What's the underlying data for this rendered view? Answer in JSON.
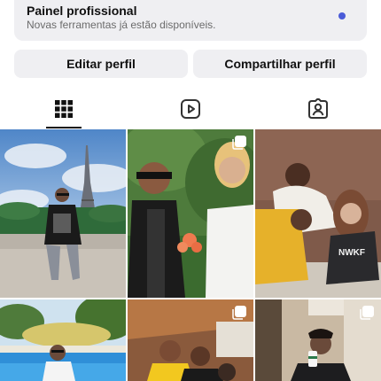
{
  "panel": {
    "title": "Painel profissional",
    "subtitle": "Novas ferramentas já estão disponíveis."
  },
  "buttons": {
    "edit_profile": "Editar perfil",
    "share_profile": "Compartilhar perfil"
  },
  "tabs": [
    {
      "name": "grid",
      "icon": "grid-icon",
      "selected": true
    },
    {
      "name": "reels",
      "icon": "reels-icon",
      "selected": false
    },
    {
      "name": "tagged",
      "icon": "tagged-icon",
      "selected": false
    }
  ],
  "colors": {
    "accent_dot": "#4a5bd8",
    "button_bg": "#efeff2"
  },
  "posts": [
    {
      "icon": "",
      "desc": "man posing near Eiffel Tower"
    },
    {
      "icon": "multiple-photos-icon",
      "desc": "two people with flower"
    },
    {
      "icon": "",
      "desc": "three people on sofa"
    },
    {
      "icon": "",
      "desc": "man by pool"
    },
    {
      "icon": "multiple-photos-icon",
      "desc": "group smiling"
    },
    {
      "icon": "multiple-photos-icon",
      "desc": "man with cup"
    }
  ]
}
